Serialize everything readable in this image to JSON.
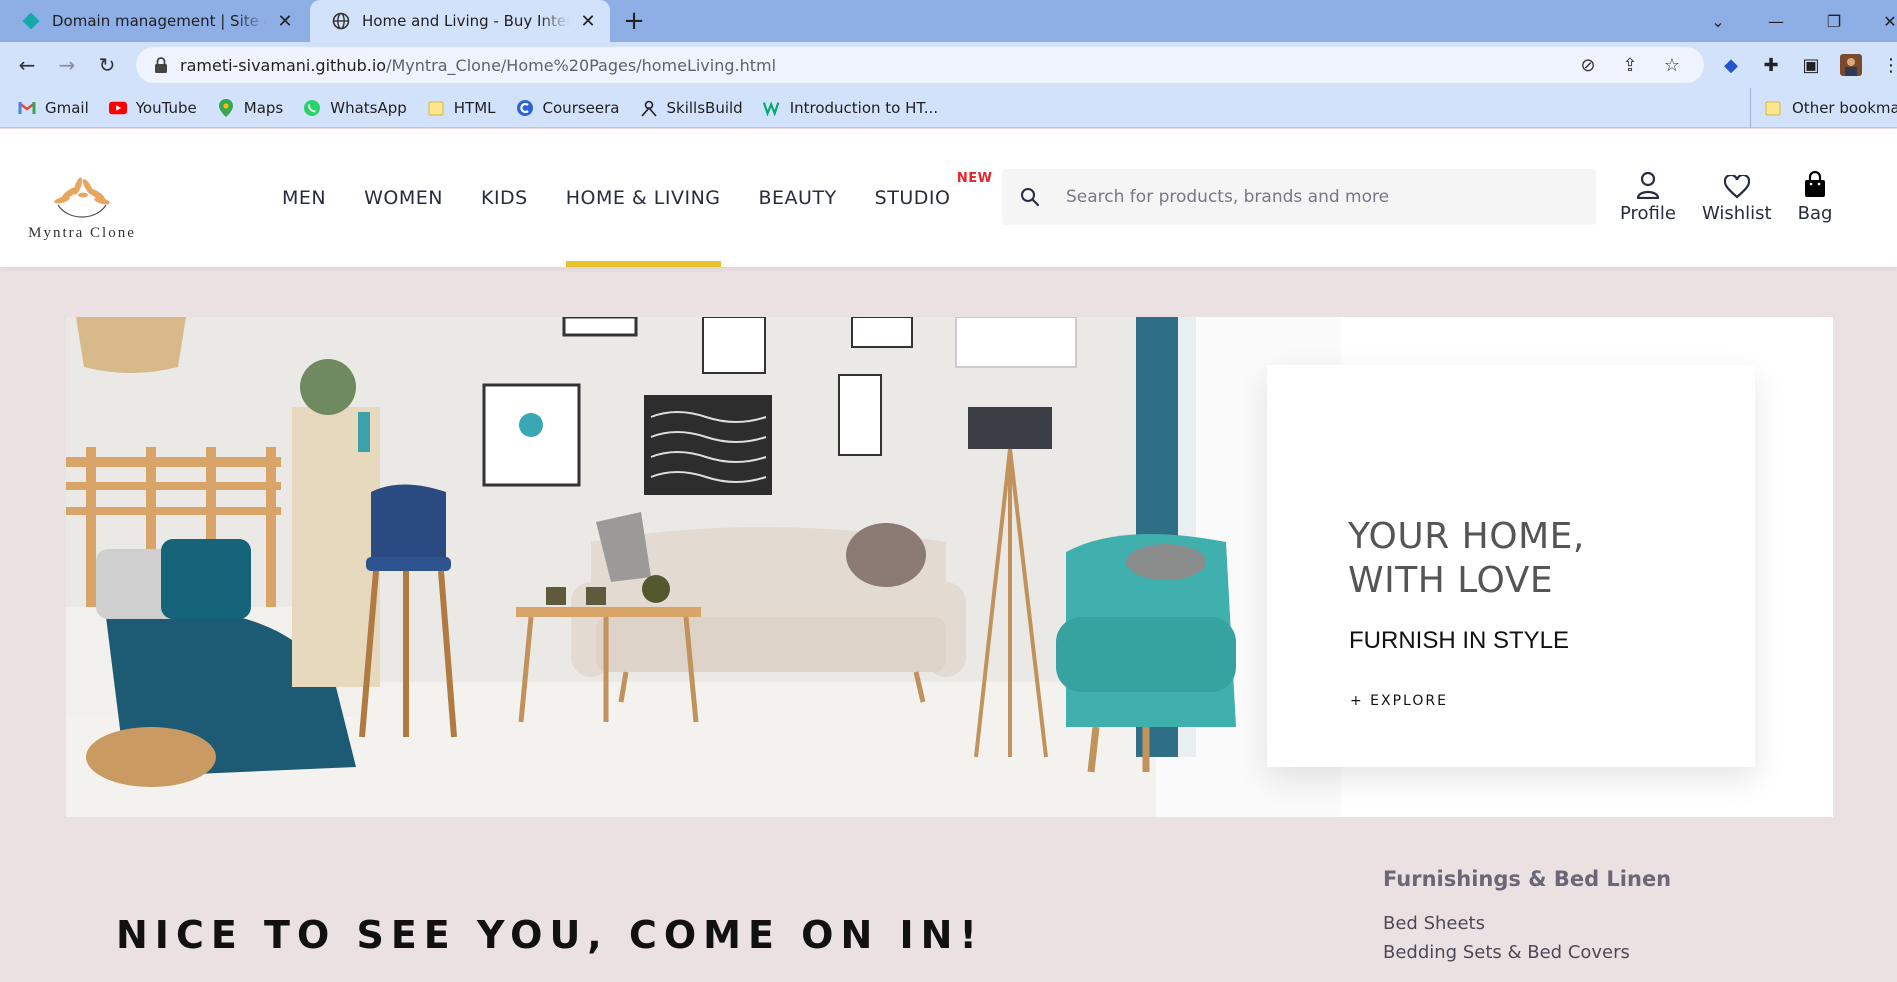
{
  "browser": {
    "tabs": [
      {
        "title": "Domain management | Site confi",
        "active": false
      },
      {
        "title": "Home and Living - Buy Interior De",
        "active": true
      }
    ],
    "url_host": "rameti-sivamani.github.io",
    "url_path": "/Myntra_Clone/Home%20Pages/homeLiving.html",
    "bookmarks": [
      "Gmail",
      "YouTube",
      "Maps",
      "WhatsApp",
      "HTML",
      "Courseera",
      "SkillsBuild",
      "Introduction to HT..."
    ],
    "other_bookmarks": "Other bookmarks"
  },
  "site": {
    "logo_text": "Myntra Clone",
    "nav": [
      "MEN",
      "WOMEN",
      "KIDS",
      "HOME & LIVING",
      "BEAUTY",
      "STUDIO"
    ],
    "new_badge": "NEW",
    "search_placeholder": "Search for products, brands and more",
    "actions": {
      "profile": "Profile",
      "wishlist": "Wishlist",
      "bag": "Bag"
    },
    "accent_color": "#e8c230"
  },
  "hero": {
    "heading_line1": "YOUR HOME,",
    "heading_line2": "WITH LOVE",
    "subheading": "FURNISH IN STYLE",
    "explore": "+ EXPLORE"
  },
  "welcome_text": "NICE TO SEE YOU, COME ON IN!",
  "side_category": {
    "title": "Furnishings & Bed Linen",
    "links": [
      "Bed Sheets",
      "Bedding Sets & Bed Covers"
    ]
  }
}
